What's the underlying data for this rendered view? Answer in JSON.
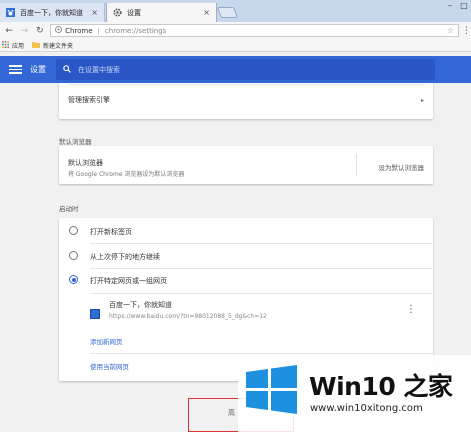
{
  "browser": {
    "tabs": [
      {
        "label": "百度一下，你就知道",
        "active": false
      },
      {
        "label": "设置",
        "active": true
      }
    ],
    "omnibox": {
      "site": "Chrome",
      "path": "chrome://settings"
    },
    "bookmarks": [
      {
        "label": "应用"
      },
      {
        "label": "新建文件夹"
      }
    ]
  },
  "settings_header": {
    "title": "设置",
    "search_placeholder": "在设置中搜索"
  },
  "search_engine": {
    "manage_label": "管理搜索引擎"
  },
  "default_browser": {
    "section_title": "默认浏览器",
    "title": "默认浏览器",
    "description": "将 Google Chrome 浏览器设为默认浏览器",
    "set_default_label": "设为默认浏览器"
  },
  "on_startup": {
    "section_title": "启动时",
    "options": [
      {
        "label": "打开新标签页",
        "selected": false
      },
      {
        "label": "从上次停下的地方继续",
        "selected": false
      },
      {
        "label": "打开特定网页或一组网页",
        "selected": true
      }
    ],
    "pages": [
      {
        "title": "百度一下，你就知道",
        "url": "https://www.baidu.com/?tn=98012088_5_dg&ch=12"
      }
    ],
    "add_page_label": "添加新网页",
    "use_current_label": "使用当前网页"
  },
  "partial_button_text": "高",
  "watermark": {
    "title": "Win10 之家",
    "url": "www.win10xitong.com"
  },
  "colors": {
    "header": "#3367d6",
    "search_box": "#2a56c6",
    "link": "#3367d6",
    "highlight_box": "#dd3333"
  }
}
